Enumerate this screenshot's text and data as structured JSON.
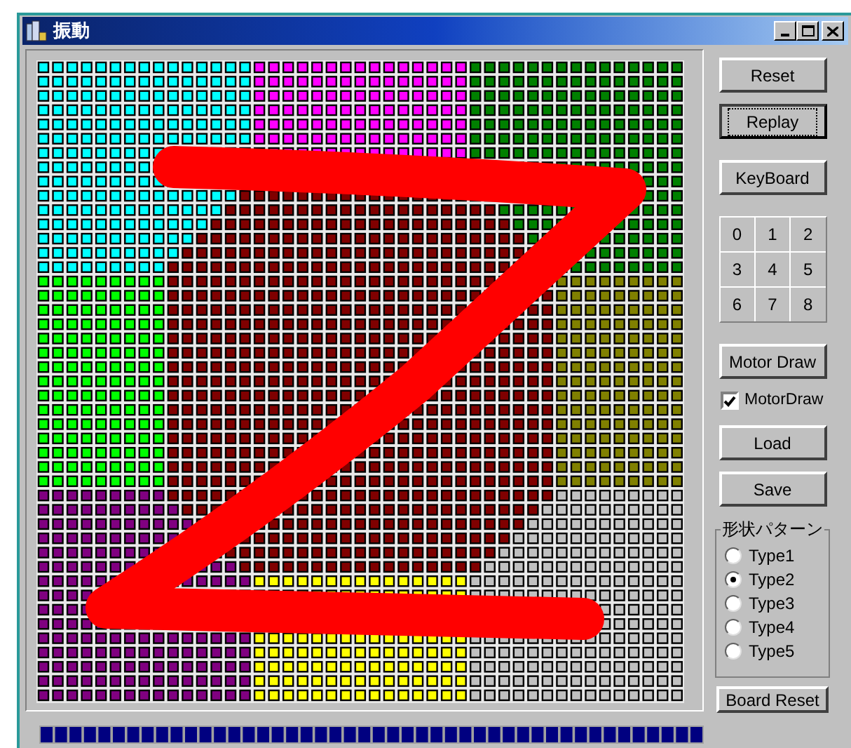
{
  "window": {
    "title": "振動"
  },
  "buttons_top": [
    {
      "label": "Reset",
      "focused": false
    },
    {
      "label": "Replay",
      "focused": true
    },
    {
      "label": "KeyBoard",
      "focused": false
    }
  ],
  "keypad": [
    "0",
    "1",
    "2",
    "3",
    "4",
    "5",
    "6",
    "7",
    "8"
  ],
  "motor_draw_button": {
    "label": "Motor Draw"
  },
  "motor_draw_checkbox": {
    "label": "MotorDraw",
    "checked": true
  },
  "buttons_mid": [
    {
      "label": "Load"
    },
    {
      "label": "Save"
    }
  ],
  "shape_pattern": {
    "title": "形状パターン",
    "options": [
      {
        "label": "Type1",
        "selected": false
      },
      {
        "label": "Type2",
        "selected": true
      },
      {
        "label": "Type3",
        "selected": false
      },
      {
        "label": "Type4",
        "selected": false
      },
      {
        "label": "Type5",
        "selected": false
      }
    ]
  },
  "board_reset_button": {
    "label": "Board Reset"
  }
}
